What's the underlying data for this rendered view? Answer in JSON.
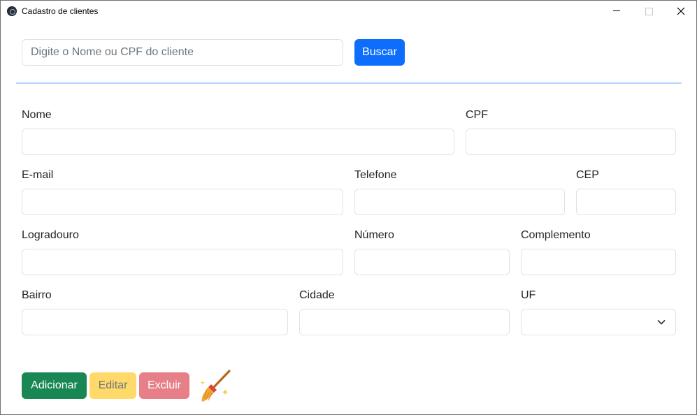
{
  "window": {
    "title": "Cadastro de clientes"
  },
  "search": {
    "placeholder": "Digite o Nome ou CPF do cliente",
    "value": "",
    "button_label": "Buscar"
  },
  "form": {
    "nome": {
      "label": "Nome",
      "value": ""
    },
    "cpf": {
      "label": "CPF",
      "value": ""
    },
    "email": {
      "label": "E-mail",
      "value": ""
    },
    "telefone": {
      "label": "Telefone",
      "value": ""
    },
    "cep": {
      "label": "CEP",
      "value": ""
    },
    "logradouro": {
      "label": "Logradouro",
      "value": ""
    },
    "numero": {
      "label": "Número",
      "value": ""
    },
    "complemento": {
      "label": "Complemento",
      "value": ""
    },
    "bairro": {
      "label": "Bairro",
      "value": ""
    },
    "cidade": {
      "label": "Cidade",
      "value": ""
    },
    "uf": {
      "label": "UF",
      "value": ""
    }
  },
  "actions": {
    "add_label": "Adicionar",
    "edit_label": "Editar",
    "delete_label": "Excluir",
    "clear_icon": "broom-icon"
  },
  "colors": {
    "primary": "#0d6efd",
    "success": "#198754",
    "warning": "#ffda6a",
    "danger": "#e77f88",
    "divider": "#b6d4fe"
  }
}
